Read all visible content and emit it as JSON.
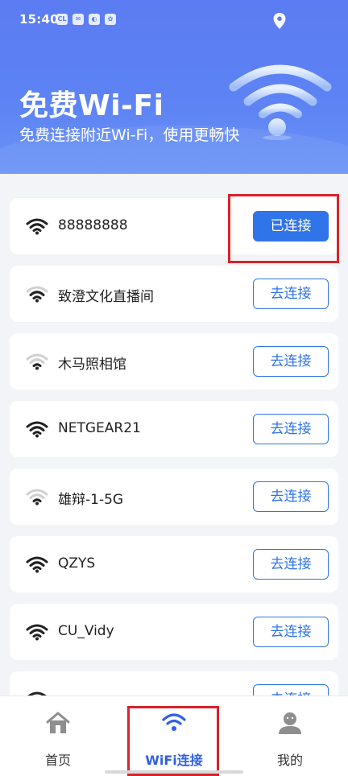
{
  "status_bar": {
    "time": "15:40",
    "notification_icons": [
      "CL",
      "✉",
      "◐",
      "✿"
    ]
  },
  "hero": {
    "title": "免费Wi-Fi",
    "subtitle": "免费连接附近Wi-Fi，使用更畅快"
  },
  "networks": [
    {
      "ssid": "88888888",
      "signal": 4,
      "button": "已连接",
      "connected": true
    },
    {
      "ssid": "致澄文化直播间",
      "signal": 2,
      "button": "去连接",
      "connected": false
    },
    {
      "ssid": "木马照相馆",
      "signal": 1,
      "button": "去连接",
      "connected": false
    },
    {
      "ssid": "NETGEAR21",
      "signal": 4,
      "button": "去连接",
      "connected": false
    },
    {
      "ssid": "雄辩-1-5G",
      "signal": 1,
      "button": "去连接",
      "connected": false
    },
    {
      "ssid": "QZYS",
      "signal": 4,
      "button": "去连接",
      "connected": false
    },
    {
      "ssid": "CU_Vidy",
      "signal": 4,
      "button": "去连接",
      "connected": false
    },
    {
      "ssid": "",
      "signal": 4,
      "button": "去连接",
      "connected": false
    }
  ],
  "bottom_nav": [
    {
      "label": "首页",
      "icon": "home-icon",
      "active": false
    },
    {
      "label": "WiFi连接",
      "icon": "wifi-icon",
      "active": true
    },
    {
      "label": "我的",
      "icon": "profile-icon",
      "active": false
    }
  ],
  "colors": {
    "header_gradient_top": "#5b7cf2",
    "primary_blue": "#2f74e8",
    "active_nav": "#2f5fe6",
    "annotation_red": "#d9222a"
  }
}
